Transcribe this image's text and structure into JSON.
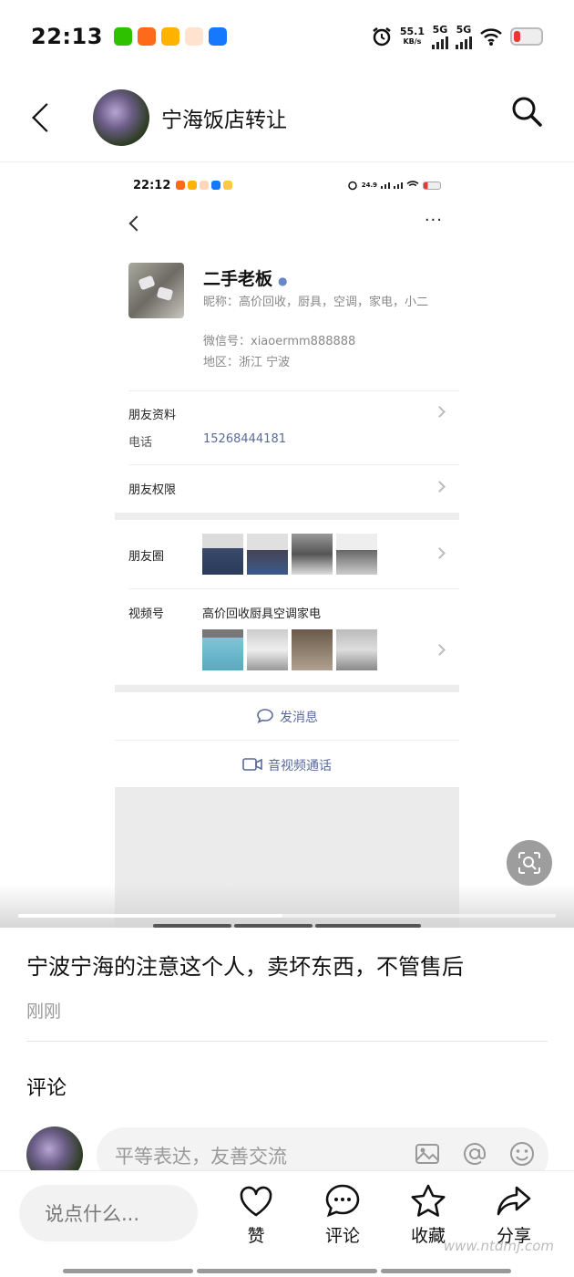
{
  "status": {
    "time": "22:13",
    "net_speed": "55.1",
    "net_unit": "KB/s",
    "sig1": "5G",
    "sig2": "5G"
  },
  "header": {
    "title": "宁海饭店转让"
  },
  "inner_screenshot": {
    "time": "22:12",
    "net_speed": "24.9",
    "net_unit": "KB/s",
    "more": "···",
    "name": "二手老板",
    "nickname": "昵称：高价回收，厨具，空调，家电，小二",
    "wechat": "微信号：xiaoermm888888",
    "region": "地区：浙江  宁波",
    "friend_info": "朋友资料",
    "phone_label": "电话",
    "phone_value": "15268444181",
    "permissions": "朋友权限",
    "moments": "朋友圈",
    "channels": "视频号",
    "channels_title": "高价回收厨具空调家电",
    "send_message": "发消息",
    "video_call": "音视频通话"
  },
  "post": {
    "text": "宁波宁海的注意这个人，卖坏东西，不管售后",
    "time": "刚刚"
  },
  "comments": {
    "title": "评论",
    "placeholder": "平等表达，友善交流"
  },
  "bottombar": {
    "say_placeholder": "说点什么...",
    "like": "赞",
    "comment": "评论",
    "favorite": "收藏",
    "share": "分享"
  },
  "watermark": "www.ntdmj.com",
  "colors": {
    "link_blue": "#5a6b9a",
    "battery_red": "#e53935"
  }
}
